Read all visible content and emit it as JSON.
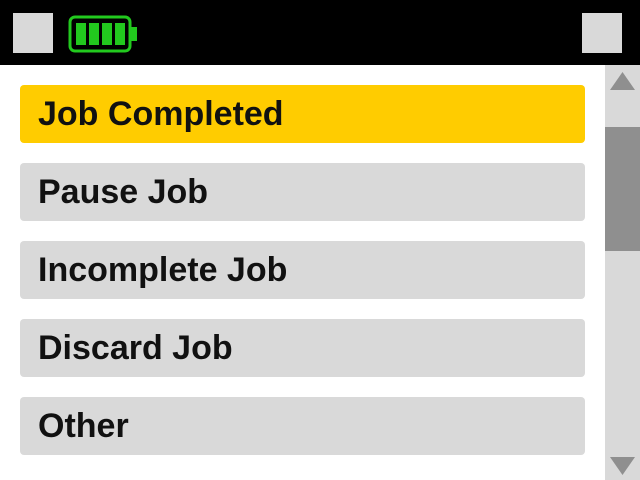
{
  "topbar": {
    "battery": {
      "icon": "battery-full-icon",
      "level": 1.0,
      "color": "#22c91e"
    }
  },
  "menu": {
    "items": [
      {
        "label": "Job Completed",
        "selected": true
      },
      {
        "label": "Pause Job",
        "selected": false
      },
      {
        "label": "Incomplete Job",
        "selected": false
      },
      {
        "label": "Discard Job",
        "selected": false
      },
      {
        "label": "Other",
        "selected": false
      }
    ]
  },
  "colors": {
    "selected": "#ffcc00",
    "item": "#d9d9d9",
    "header": "#000000",
    "scroll_thumb": "#8f8f8f"
  }
}
